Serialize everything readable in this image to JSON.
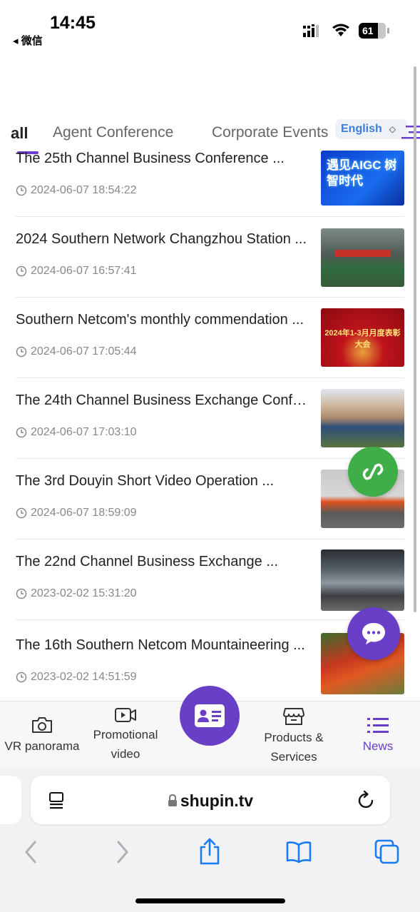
{
  "status_bar": {
    "time": "14:45",
    "back_app": "◂ 微信",
    "battery": "61"
  },
  "tabs": {
    "items": [
      {
        "label": "all",
        "active": true
      },
      {
        "label": "Agent Conference",
        "active": false
      },
      {
        "label": "Corporate Events",
        "active": false
      }
    ],
    "language": "English"
  },
  "news_list": [
    {
      "title": "The 25th Channel Business Conference ...",
      "date": "2024-06-07 18:54:22",
      "thumb_text": "遇见AIGC 树智时代"
    },
    {
      "title": "2024 Southern Network Changzhou Station ...",
      "date": "2024-06-07 16:57:41"
    },
    {
      "title": "Southern Netcom's monthly commendation ...",
      "date": "2024-06-07 17:05:44",
      "thumb_text": "2024年1-3月月度表彰大会"
    },
    {
      "title": "The 24th Channel Business Exchange Conference",
      "date": "2024-06-07 17:03:10"
    },
    {
      "title": "The 3rd Douyin Short Video Operation ...",
      "date": "2024-06-07 18:59:09"
    },
    {
      "title": "The 22nd Channel Business Exchange ...",
      "date": "2023-02-02 15:31:20"
    },
    {
      "title": "The 16th Southern Netcom Mountaineering ...",
      "date": "2023-02-02 14:51:59"
    }
  ],
  "bottom_nav": [
    {
      "label": "VR panorama",
      "icon": "camera-icon"
    },
    {
      "label": "Promotional video",
      "icon": "video-icon"
    },
    {
      "label": "",
      "icon": "business-card-icon"
    },
    {
      "label": "Products & Services",
      "icon": "store-icon"
    },
    {
      "label": "News",
      "icon": "list-icon",
      "active": true
    }
  ],
  "browser": {
    "url": "shupin.tv"
  },
  "colors": {
    "accent": "#6a3fc8",
    "green": "#3fae49",
    "link_blue": "#3a7de0"
  }
}
